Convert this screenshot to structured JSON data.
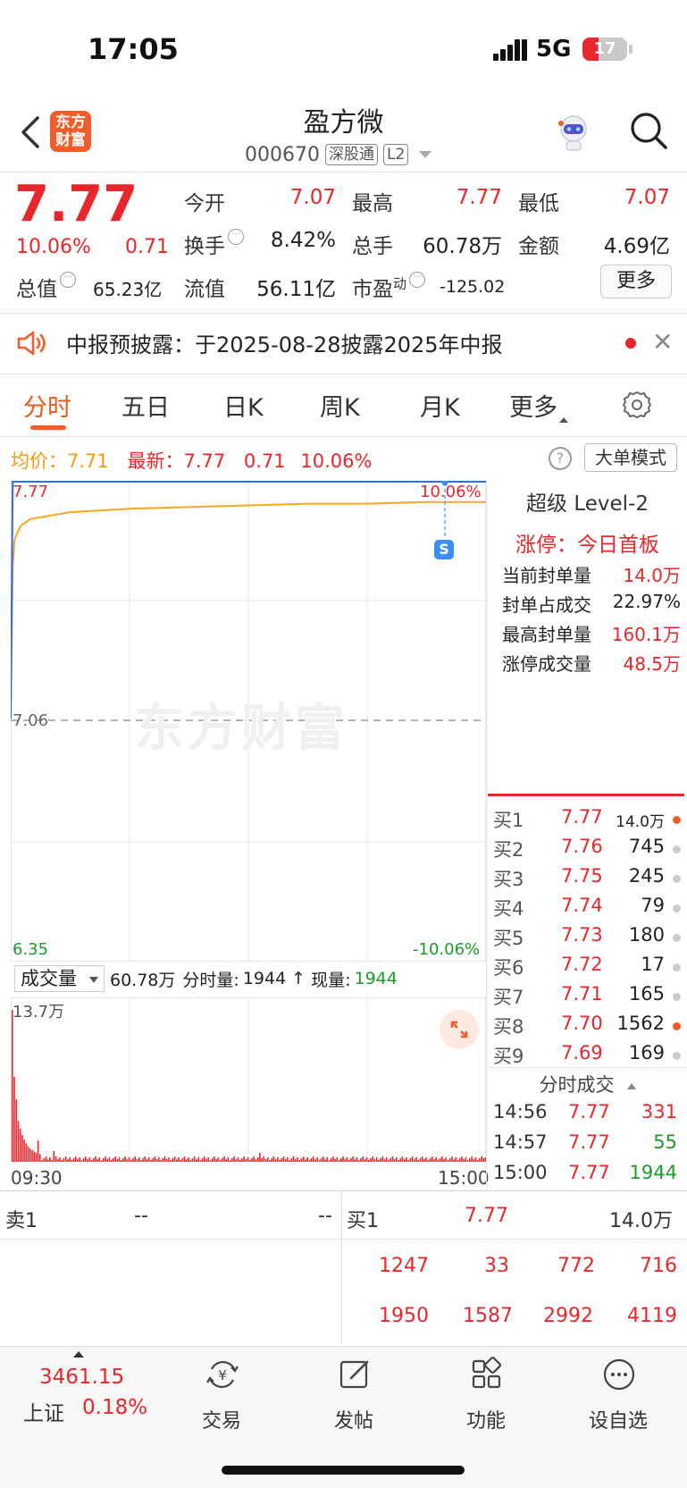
{
  "status": {
    "time": "17:05",
    "network": "5G",
    "battery": "17"
  },
  "header": {
    "logo_line1": "东方",
    "logo_line2": "财富",
    "name": "盈方微",
    "code": "000670",
    "tag_market": "深股通",
    "tag_level": "L2"
  },
  "quote": {
    "price": "7.77",
    "change_pct": "10.06%",
    "change_amt": "0.71",
    "open_label": "今开",
    "open": "7.07",
    "high_label": "最高",
    "high": "7.77",
    "low_label": "最低",
    "low": "7.07",
    "turnover_label": "换手",
    "turnover": "8.42%",
    "volume_label": "总手",
    "volume": "60.78万",
    "amount_label": "金额",
    "amount": "4.69亿",
    "mktcap_label": "总值",
    "mktcap": "65.23亿",
    "float_label": "流值",
    "float": "56.11亿",
    "pe_label": "市盈",
    "pe_sup": "动",
    "pe": "-125.02",
    "more_label": "更多"
  },
  "notice": {
    "text": "中报预披露：于2025-08-28披露2025年中报"
  },
  "tabs": [
    "分时",
    "五日",
    "日K",
    "周K",
    "月K",
    "更多"
  ],
  "info_row": {
    "avg_label": "均价：",
    "avg": "7.71",
    "latest_label": "最新：",
    "latest": "7.77",
    "chg": "0.71",
    "pct": "10.06%",
    "help": "?",
    "bigorder_label": "大单模式"
  },
  "chart": {
    "top_price": "7.77",
    "top_pct": "10.06%",
    "mid_price": "7.06",
    "bottom_price": "6.35",
    "bottom_pct": "-10.06%",
    "watermark": "东方财富",
    "marker": "S",
    "vol_selector": "成交量",
    "vol_total": "60.78万",
    "vol_fen_label": "分时量:",
    "vol_fen": "1944",
    "vol_now_label": "现量:",
    "vol_now": "1944",
    "vol_max": "13.7万",
    "time_start": "09:30",
    "time_end": "15:00"
  },
  "chart_data": {
    "type": "line",
    "title": "",
    "x": [
      "09:30",
      "09:31",
      "09:32",
      "09:35",
      "09:40",
      "09:50",
      "10:00",
      "10:30",
      "11:00",
      "11:30",
      "13:00",
      "13:30",
      "14:00",
      "14:30",
      "14:57",
      "15:00"
    ],
    "series": [
      {
        "name": "均价",
        "values": [
          7.07,
          7.52,
          7.6,
          7.64,
          7.66,
          7.67,
          7.68,
          7.69,
          7.695,
          7.7,
          7.7,
          7.705,
          7.705,
          7.71,
          7.71,
          7.71
        ]
      },
      {
        "name": "最新",
        "values": [
          7.07,
          7.77,
          7.77,
          7.77,
          7.77,
          7.77,
          7.77,
          7.77,
          7.77,
          7.77,
          7.77,
          7.77,
          7.77,
          7.77,
          7.77,
          7.77
        ]
      }
    ],
    "ylim": [
      6.35,
      7.77
    ],
    "reference": 7.06
  },
  "level2": {
    "title": "超级 Level-2",
    "status": "涨停：今日首板",
    "stats": [
      {
        "label": "当前封单量",
        "value": "14.0万"
      },
      {
        "label": "封单占成交",
        "value": "22.97%"
      },
      {
        "label": "最高封单量",
        "value": "160.1万"
      },
      {
        "label": "涨停成交量",
        "value": "48.5万"
      }
    ],
    "bids": [
      {
        "label": "买1",
        "price": "7.77",
        "vol": "14.0万"
      },
      {
        "label": "买2",
        "price": "7.76",
        "vol": "745"
      },
      {
        "label": "买3",
        "price": "7.75",
        "vol": "245"
      },
      {
        "label": "买4",
        "price": "7.74",
        "vol": "79"
      },
      {
        "label": "买5",
        "price": "7.73",
        "vol": "180"
      },
      {
        "label": "买6",
        "price": "7.72",
        "vol": "17"
      },
      {
        "label": "买7",
        "price": "7.71",
        "vol": "165"
      },
      {
        "label": "买8",
        "price": "7.70",
        "vol": "1562"
      },
      {
        "label": "买9",
        "price": "7.69",
        "vol": "169"
      }
    ],
    "ticks_title": "分时成交",
    "ticks": [
      {
        "time": "14:56",
        "price": "7.77",
        "vol": "331"
      },
      {
        "time": "14:57",
        "price": "7.77",
        "vol": "55"
      },
      {
        "time": "15:00",
        "price": "7.77",
        "vol": "1944"
      }
    ]
  },
  "bottom_book": {
    "sell_label": "卖1",
    "sell_price": "--",
    "sell_vol": "--",
    "buy_label": "买1",
    "buy_price": "7.77",
    "buy_vol": "14.0万",
    "queue_row1": [
      "1247",
      "33",
      "772",
      "716"
    ],
    "queue_row2": [
      "1950",
      "1587",
      "2992",
      "4119"
    ]
  },
  "nav": {
    "index_value": "3461.15",
    "index_name": "上证",
    "index_pct": "0.18%",
    "items": [
      "交易",
      "发帖",
      "功能",
      "设自选"
    ]
  }
}
